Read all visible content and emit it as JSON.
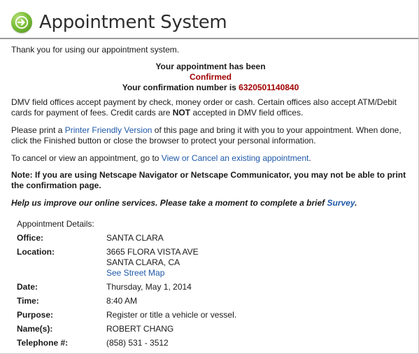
{
  "header": {
    "title": "Appointment System",
    "icon": "arrow-right-circle-icon",
    "icon_color": "#7cbf3a"
  },
  "intro": "Thank you for using our appointment system.",
  "confirmation": {
    "line1": "Your appointment has been",
    "status": "Confirmed",
    "number_prefix": "Your confirmation number is",
    "number": "6320501140840",
    "accent_color": "#a00000"
  },
  "payment": {
    "text_before": "DMV field offices accept payment by check, money order or cash. Certain offices also accept ATM/Debit cards for payment of fees. Credit cards are ",
    "emphasis": "NOT",
    "text_after": " accepted in DMV field offices."
  },
  "print": {
    "text_before": "Please print a ",
    "link": "Printer Friendly Version",
    "text_after": " of this page and bring it with you to your appointment. When done, click the Finished button or close the browser to protect your personal information."
  },
  "cancel": {
    "text_before": "To cancel or view an appointment, go to ",
    "link": "View or Cancel an existing appointment",
    "text_after": "."
  },
  "note": "Note: If you are using Netscape Navigator or Netscape Communicator, you may not be able to print the confirmation page.",
  "survey": {
    "text_before": "Help us improve our online services. Please take a moment to complete a brief ",
    "link": "Survey",
    "text_after": "."
  },
  "details": {
    "heading": "Appointment Details:",
    "office_label": "Office:",
    "office_value": "SANTA CLARA",
    "location_label": "Location:",
    "location_line1": "3665 FLORA VISTA AVE",
    "location_line2": "SANTA CLARA, CA",
    "location_link": "See Street Map",
    "date_label": "Date:",
    "date_value": "Thursday, May 1, 2014",
    "time_label": "Time:",
    "time_value": "8:40 AM",
    "purpose_label": "Purpose:",
    "purpose_value": "Register or title a vehicle or vessel.",
    "names_label": "Name(s):",
    "names_value": "ROBERT CHANG",
    "phone_label": "Telephone #:",
    "phone_value": "(858) 531 - 3512"
  },
  "colors": {
    "link": "#1f58a8",
    "divider": "#9a9a9a"
  }
}
